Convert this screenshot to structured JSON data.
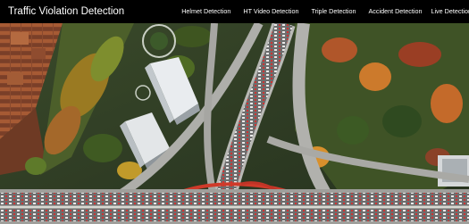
{
  "navbar": {
    "brand": "Traffic Violation Detection",
    "links": [
      "Helmet Detection",
      "HT Video Detection",
      "Triple Detection",
      "Accident Detection",
      "Live Detection"
    ]
  },
  "hero": {
    "image": "aerial-highway-interchange-city-photo"
  },
  "colors": {
    "navbar_bg": "#000000",
    "navbar_text": "#ffffff"
  }
}
